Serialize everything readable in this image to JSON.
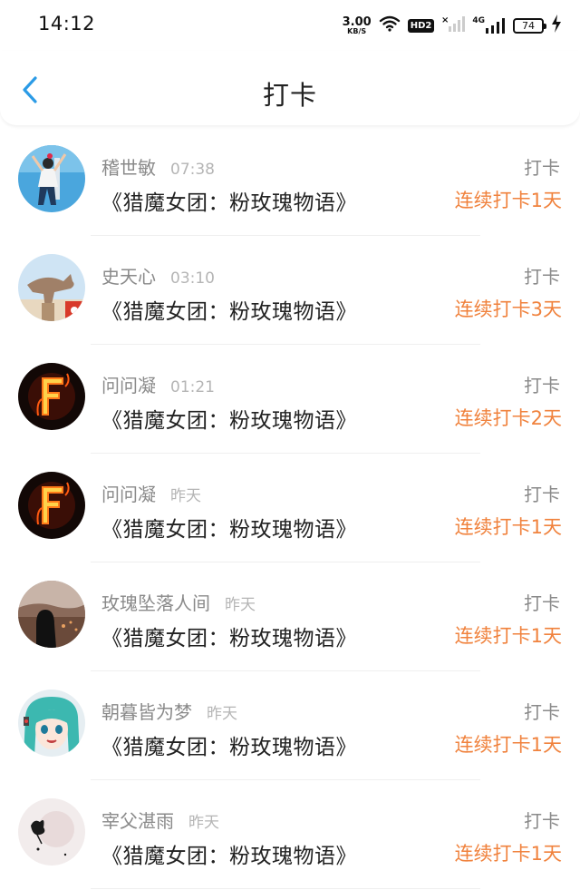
{
  "status_bar": {
    "time": "14:12",
    "net_speed_value": "3.00",
    "net_speed_unit": "KB/S",
    "hd_label": "HD2",
    "network_label": "4G",
    "battery": "74"
  },
  "header": {
    "title": "打卡"
  },
  "colors": {
    "accent_orange": "#f0823d",
    "back_blue": "#2b9be6"
  },
  "items": [
    {
      "name": "稽世敏",
      "time": "07:38",
      "book": "《猎魔女团：粉玫瑰物语》",
      "type": "打卡",
      "streak": "连续打卡1天",
      "avatar": "person-avatar-1"
    },
    {
      "name": "史天心",
      "time": "03:10",
      "book": "《猎魔女团：粉玫瑰物语》",
      "type": "打卡",
      "streak": "连续打卡3天",
      "avatar": "statue-avatar"
    },
    {
      "name": "问问凝",
      "time": "01:21",
      "book": "《猎魔女团：粉玫瑰物语》",
      "type": "打卡",
      "streak": "连续打卡2天",
      "avatar": "fire-f-avatar"
    },
    {
      "name": "问问凝",
      "time": "昨天",
      "book": "《猎魔女团：粉玫瑰物语》",
      "type": "打卡",
      "streak": "连续打卡1天",
      "avatar": "fire-f-avatar"
    },
    {
      "name": "玫瑰坠落人间",
      "time": "昨天",
      "book": "《猎魔女团：粉玫瑰物语》",
      "type": "打卡",
      "streak": "连续打卡1天",
      "avatar": "silhouette-avatar"
    },
    {
      "name": "朝暮皆为梦",
      "time": "昨天",
      "book": "《猎魔女团：粉玫瑰物语》",
      "type": "打卡",
      "streak": "连续打卡1天",
      "avatar": "anime-avatar"
    },
    {
      "name": "宰父湛雨",
      "time": "昨天",
      "book": "《猎魔女团：粉玫瑰物语》",
      "type": "打卡",
      "streak": "连续打卡1天",
      "avatar": "sketch-avatar"
    }
  ]
}
